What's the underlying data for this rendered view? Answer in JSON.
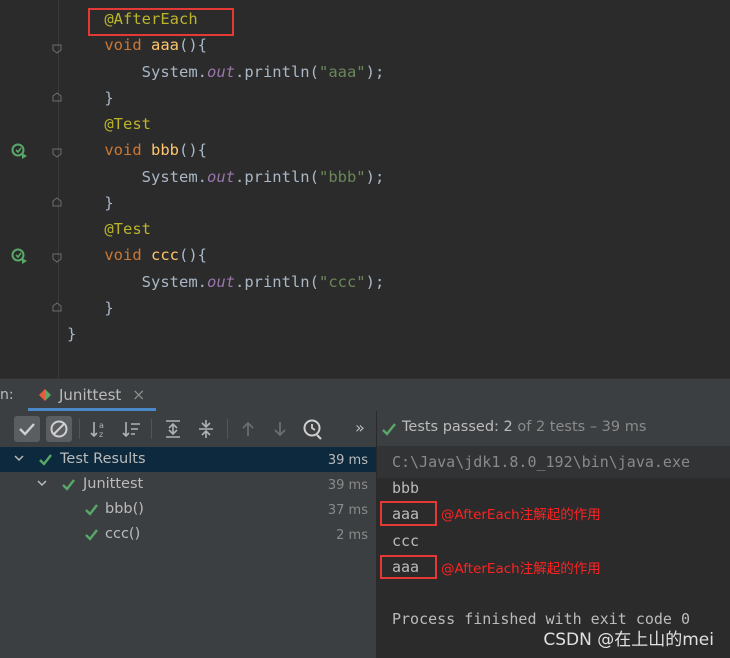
{
  "editor": {
    "lines": [
      {
        "kind": "annotation",
        "indent": "    ",
        "text": "@AfterEach"
      },
      {
        "kind": "method",
        "indent": "    ",
        "keyword": "void",
        "name": "aaa",
        "rest": "(){"
      },
      {
        "kind": "println",
        "indent": "        ",
        "obj": "System.",
        "field": "out",
        "call": ".println(",
        "arg": "\"aaa\"",
        "end": ");"
      },
      {
        "kind": "plain",
        "indent": "    ",
        "text": "}"
      },
      {
        "kind": "annotation",
        "indent": "    ",
        "text": "@Test"
      },
      {
        "kind": "method",
        "indent": "    ",
        "keyword": "void",
        "name": "bbb",
        "rest": "(){"
      },
      {
        "kind": "println",
        "indent": "        ",
        "obj": "System.",
        "field": "out",
        "call": ".println(",
        "arg": "\"bbb\"",
        "end": ");"
      },
      {
        "kind": "plain",
        "indent": "    ",
        "text": "}"
      },
      {
        "kind": "annotation",
        "indent": "    ",
        "text": "@Test"
      },
      {
        "kind": "method",
        "indent": "    ",
        "keyword": "void",
        "name": "ccc",
        "rest": "(){"
      },
      {
        "kind": "println",
        "indent": "        ",
        "obj": "System.",
        "field": "out",
        "call": ".println(",
        "arg": "\"ccc\"",
        "end": ");"
      },
      {
        "kind": "plain",
        "indent": "    ",
        "text": "}"
      },
      {
        "kind": "plain",
        "indent": "",
        "text": "}"
      }
    ]
  },
  "run_panel": {
    "prefix": "n:",
    "tab_label": "Junittest",
    "tab_close": "×"
  },
  "toolbar": {
    "more": "»",
    "buttons": [
      "show-passed-icon",
      "show-ignored-icon",
      "sort-alpha-icon",
      "sort-duration-icon",
      "expand-all-icon",
      "collapse-all-icon",
      "prev-failed-icon",
      "next-failed-icon",
      "test-history-icon"
    ]
  },
  "status": {
    "label": "Tests passed:",
    "passed": "2",
    "rest": "of 2 tests – 39 ms"
  },
  "tree": [
    {
      "label": "Test Results",
      "time": "39 ms",
      "level": 0,
      "expandable": true,
      "selected": true
    },
    {
      "label": "Junittest",
      "time": "39 ms",
      "level": 1,
      "expandable": true,
      "selected": false
    },
    {
      "label": "bbb()",
      "time": "37 ms",
      "level": 2,
      "expandable": false,
      "selected": false
    },
    {
      "label": "ccc()",
      "time": "2 ms",
      "level": 2,
      "expandable": false,
      "selected": false
    }
  ],
  "console": {
    "lines": [
      "C:\\Java\\jdk1.8.0_192\\bin\\java.exe",
      "bbb",
      "aaa",
      "ccc",
      "aaa",
      "",
      "Process finished with exit code 0"
    ],
    "notes": [
      "@AfterEach注解起的作用",
      "@AfterEach注解起的作用"
    ]
  },
  "watermark": "CSDN @在上山的mei",
  "colors": {
    "editor_bg": "#2b2b2b",
    "panel_bg": "#3c3f41",
    "keyword": "#cc7832",
    "annotation": "#bbb529",
    "method": "#ffc66d",
    "string": "#6a8759",
    "field": "#9876aa",
    "pass_green": "#59a869",
    "highlight_red": "#e53935"
  }
}
